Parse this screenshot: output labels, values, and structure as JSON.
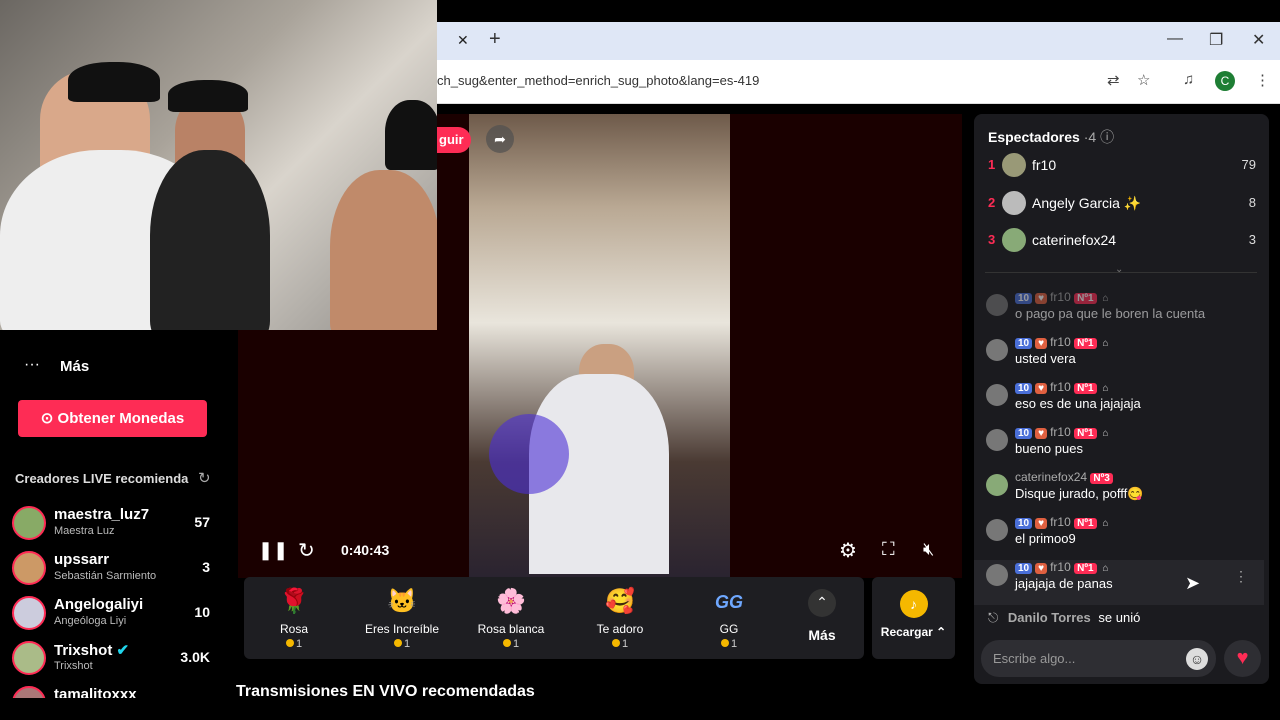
{
  "browser": {
    "url": "ch_sug&enter_method=enrich_sug_photo&lang=es-419",
    "profile_initial": "C",
    "tab_close": "✕",
    "new_tab": "+",
    "win_min": "—",
    "win_max": "❐",
    "win_close": "✕"
  },
  "sidebar": {
    "more_label": "Más",
    "coins_button": "Obtener Monedas",
    "creators_title": "Creadores LIVE recomienda",
    "creators": [
      {
        "name": "maestra_luz7",
        "sub": "Maestra Luz",
        "count": "57"
      },
      {
        "name": "upssarr",
        "sub": "Sebastián Sarmiento",
        "count": "3"
      },
      {
        "name": "Angelogaliyi",
        "sub": "Angeóloga Liyi",
        "count": "10"
      },
      {
        "name": "Trixshot",
        "sub": "Trixshot",
        "count": "3.0K"
      },
      {
        "name": "tamalitoxxx",
        "sub": "",
        "count": ""
      }
    ]
  },
  "video": {
    "follow_label": "guir",
    "time": "0:40:43"
  },
  "recommended_title": "Transmisiones EN VIVO recomendadas",
  "gifts": [
    {
      "name": "Rosa",
      "price": "1",
      "icon": "🌹"
    },
    {
      "name": "Eres Increíble",
      "price": "1",
      "icon": "🐱"
    },
    {
      "name": "Rosa blanca",
      "price": "1",
      "icon": "🌸"
    },
    {
      "name": "Te adoro",
      "price": "1",
      "icon": "🥰"
    },
    {
      "name": "GG",
      "price": "1",
      "icon": "GG"
    }
  ],
  "gifts_more": "Más",
  "recargar": "Recargar",
  "chat": {
    "viewers_title": "Espectadores",
    "viewers_count": "·4",
    "viewers": [
      {
        "rank": "1",
        "name": "fr10",
        "score": "79"
      },
      {
        "rank": "2",
        "name": "Angely Garcia ✨",
        "score": "8"
      },
      {
        "rank": "3",
        "name": "caterinefox24",
        "score": "3"
      }
    ],
    "messages": [
      {
        "level": "10",
        "user": "fr10",
        "fan": "Nº1",
        "text": "o pago pa que le boren la cuenta"
      },
      {
        "level": "10",
        "user": "fr10",
        "fan": "Nº1",
        "text": "usted vera"
      },
      {
        "level": "10",
        "user": "fr10",
        "fan": "Nº1",
        "text": "eso es de una jajajaja"
      },
      {
        "level": "10",
        "user": "fr10",
        "fan": "Nº1",
        "text": "bueno pues"
      },
      {
        "level": "",
        "user": "caterinefox24",
        "fan": "Nº3",
        "text": "Disque jurado, pofff😋"
      },
      {
        "level": "10",
        "user": "fr10",
        "fan": "Nº1",
        "text": "el primoo9"
      },
      {
        "level": "10",
        "user": "fr10",
        "fan": "Nº1",
        "text": "jajajaja de panas"
      }
    ],
    "joined_user": "Danilo Torres",
    "joined_text": "se unió",
    "input_placeholder": "Escribe algo..."
  }
}
